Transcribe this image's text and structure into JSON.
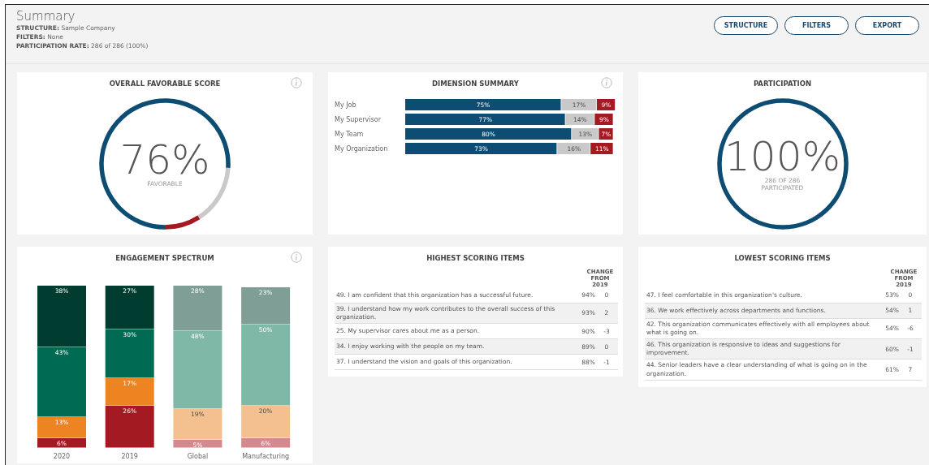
{
  "header": {
    "title": "Summary",
    "meta": [
      {
        "label": "STRUCTURE:",
        "value": "Sample Company"
      },
      {
        "label": "FILTERS:",
        "value": "None"
      },
      {
        "label": "PARTICIPATION RATE:",
        "value": "286 of 286 (100%)"
      }
    ]
  },
  "buttons": [
    "STRUCTURE",
    "FILTERS",
    "EXPORT"
  ],
  "overall": {
    "title": "OVERALL FAVORABLE SCORE",
    "info": true,
    "value": "76%",
    "caption": "FAVORABLE",
    "chart_data": {
      "type": "donut",
      "values": [
        76,
        15,
        9
      ],
      "colors": [
        "#0e4d73",
        "#c9c9c9",
        "#a31a23"
      ]
    }
  },
  "dimension": {
    "title": "DIMENSION SUMMARY",
    "info": true,
    "chart_data": {
      "type": "bar",
      "orientation": "horizontal",
      "stacked": true,
      "categories": [
        "My Job",
        "My Supervisor",
        "My Team",
        "My Organization"
      ],
      "series": [
        {
          "color": "#0e4d73",
          "values": [
            75,
            77,
            80,
            73
          ],
          "value_labels": [
            "75%",
            "77%",
            "80%",
            "73%"
          ]
        },
        {
          "color": "#c9c9c9",
          "values": [
            17,
            14,
            13,
            16
          ],
          "value_labels": [
            "17%",
            "14%",
            "13%",
            "16%"
          ]
        },
        {
          "color": "#a31a23",
          "values": [
            9,
            9,
            7,
            11
          ],
          "value_labels": [
            "9%",
            "9%",
            "7%",
            "11%"
          ]
        }
      ]
    }
  },
  "participation": {
    "title": "PARTICIPATION",
    "info": false,
    "value": "100%",
    "caption": "286 OF 286 PARTICIPATED",
    "segments": [
      {
        "level": 1,
        "color": "#0e4d73"
      }
    ]
  },
  "engagement": {
    "title": "ENGAGEMENT SPECTRUM",
    "info": true,
    "chart_data": {
      "type": "bar",
      "orientation": "vertical",
      "stacked": true,
      "categories": [
        "2020",
        "2019",
        "Global",
        "Manufacturing"
      ],
      "series": [
        {
          "color": "#a31a23",
          "values": [
            6,
            26,
            null,
            null
          ],
          "value_labels": [
            "6%",
            "26%",
            null,
            null
          ]
        },
        {
          "color": "#ee8322",
          "values": [
            13,
            17,
            null,
            null
          ],
          "value_labels": [
            "13%",
            "17%",
            null,
            null
          ]
        },
        {
          "color": "#006b52",
          "values": [
            43,
            30,
            null,
            null
          ],
          "value_labels": [
            "43%",
            "30%",
            null,
            null
          ]
        },
        {
          "color": "#003d30",
          "values": [
            38,
            27,
            null,
            null
          ],
          "value_labels": [
            "38%",
            "27%",
            null,
            null
          ]
        },
        {
          "color": "#d4898e",
          "values": [
            null,
            null,
            5,
            6
          ],
          "value_labels": [
            null,
            null,
            "5%",
            "6%"
          ]
        },
        {
          "color": "#f5c090",
          "values": [
            null,
            null,
            19,
            20
          ],
          "value_labels": [
            null,
            null,
            "19%",
            "20%"
          ]
        },
        {
          "color": "#80b8a8",
          "values": [
            null,
            null,
            48,
            50
          ],
          "value_labels": [
            null,
            null,
            "48%",
            "50%"
          ]
        },
        {
          "color": "#7f9e96",
          "values": [
            null,
            null,
            28,
            23
          ],
          "value_labels": [
            null,
            null,
            "28%",
            "23%"
          ]
        }
      ]
    }
  },
  "highest": {
    "title": "HIGHEST SCORING ITEMS",
    "change_header": "CHANGE FROM 2019",
    "rows": [
      {
        "item": "49. I am confident that this organization has a successful future.",
        "score": "94%",
        "change": "0"
      },
      {
        "item": "39. I understand how my work contributes to the overall success of this organization.",
        "score": "93%",
        "change": "2"
      },
      {
        "item": "25. My supervisor cares about me as a person.",
        "score": "90%",
        "change": "-3"
      },
      {
        "item": "34. I enjoy working with the people on my team.",
        "score": "89%",
        "change": "0"
      },
      {
        "item": "37. I understand the vision and goals of this organization.",
        "score": "88%",
        "change": "-1"
      }
    ]
  },
  "lowest": {
    "title": "LOWEST SCORING ITEMS",
    "change_header": "CHANGE FROM 2019",
    "rows": [
      {
        "item": "47. I feel comfortable in this organization's culture.",
        "score": "53%",
        "change": "0"
      },
      {
        "item": "36. We work effectively across departments and functions.",
        "score": "54%",
        "change": "1"
      },
      {
        "item": "42. This organization communicates effectively with all employees about what is going on.",
        "score": "54%",
        "change": "-6"
      },
      {
        "item": "46. This organization is responsive to ideas and suggestions for improvement.",
        "score": "60%",
        "change": "-1"
      },
      {
        "item": "44. Senior leaders have a clear understanding of what is going on in the organization.",
        "score": "61%",
        "change": "7"
      }
    ]
  }
}
